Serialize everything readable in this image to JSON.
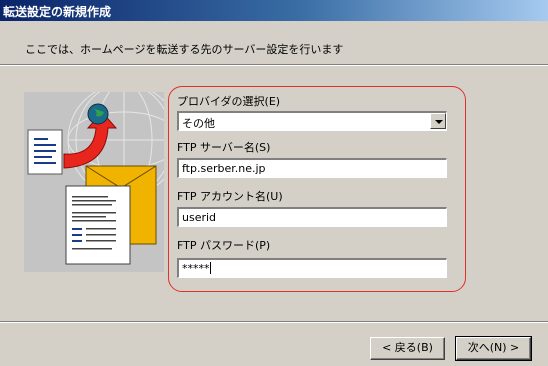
{
  "window": {
    "title": "転送設定の新規作成"
  },
  "description": "ここでは、ホームページを転送する先のサーバー設定を行います",
  "illustration": {
    "icons": [
      "document-icon",
      "curved-arrow-icon",
      "globe-icon",
      "envelope-icon",
      "report-page-icon",
      "wireframe-globe-icon"
    ]
  },
  "form": {
    "provider_label": "プロバイダの選択(E)",
    "provider_value": "その他",
    "server_label": "FTP サーバー名(S)",
    "server_value": "ftp.serber.ne.jp",
    "account_label": "FTP アカウント名(U)",
    "account_value": "userid",
    "password_label": "FTP パスワード(P)",
    "password_value": "*****"
  },
  "buttons": {
    "back": "< 戻る(B)",
    "next": "次へ(N) >"
  },
  "colors": {
    "group_border": "#e0302a",
    "title_gradient_start": "#0a246a",
    "dialog_background": "#d4d0c8"
  }
}
